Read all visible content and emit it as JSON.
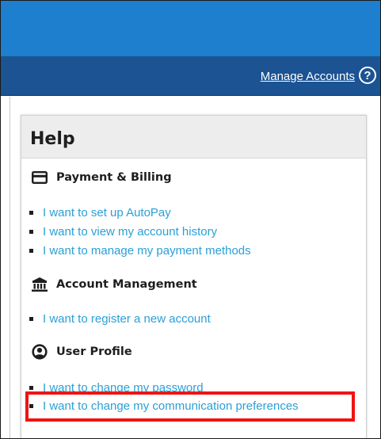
{
  "header": {
    "manage_accounts_label": "Manage Accounts",
    "help_icon_glyph": "?"
  },
  "help": {
    "title": "Help",
    "sections": [
      {
        "label": "Payment & Billing",
        "icon": "credit-card-icon",
        "links": [
          "I want to set up AutoPay",
          "I want to view my account history",
          "I want to manage my payment methods"
        ]
      },
      {
        "label": "Account Management",
        "icon": "bank-icon",
        "links": [
          "I want to register a new account"
        ]
      },
      {
        "label": "User Profile",
        "icon": "user-circle-icon",
        "links": [
          "I want to change my password",
          "I want to change my communication preferences"
        ]
      }
    ]
  },
  "colors": {
    "top_bar": "#1d7fce",
    "nav_bar": "#1b5393",
    "link": "#2a9fd6",
    "highlight": "#f01414"
  }
}
